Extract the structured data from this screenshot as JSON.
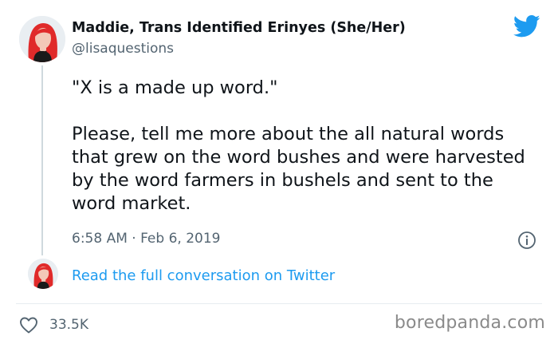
{
  "author": {
    "display_name": "Maddie, Trans Identified Erinyes (She/Her)",
    "handle": "@lisaquestions"
  },
  "tweet": {
    "text": "\"X is a made up word.\"\n\nPlease, tell me more about the all natural words that grew on the word bushes and were harvested by the word farmers in bushels and sent to the word market.",
    "timestamp": "6:58 AM · Feb 6, 2019"
  },
  "thread": {
    "read_more_label": "Read the full conversation on Twitter"
  },
  "engagement": {
    "likes": "33.5K"
  },
  "watermark": "boredpanda.com",
  "icons": {
    "platform": "twitter-bird-icon",
    "info": "info-icon",
    "like": "heart-icon"
  },
  "colors": {
    "accent": "#1d9bf0",
    "secondary_text": "#536471",
    "primary_text": "#0f1419",
    "avatar_hair": "#e02a2a"
  }
}
